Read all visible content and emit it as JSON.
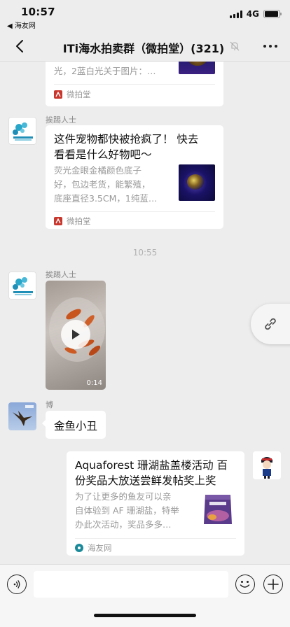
{
  "status": {
    "time": "10:57",
    "back_app": "◀ 海友网",
    "network": "4G",
    "battery_level": 0.95
  },
  "nav": {
    "title": "ITi海水拍卖群（微拍堂）(321)"
  },
  "messages": {
    "card0": {
      "desc_line1": "光，2蓝白光关于图片：…",
      "source": "微拍堂"
    },
    "card1": {
      "sender": "挨踢人士",
      "title_line1": "这件宠物都快被抢疯了！ 快去",
      "title_line2": "看看是什么好物吧～",
      "desc_line1": "荧光金眼金橘颜色底子",
      "desc_line2": "好，包边老货，能繁殖，",
      "desc_line3": "底座直径3.5CM，1纯蓝…",
      "source": "微拍堂"
    },
    "timestamp": "10:55",
    "video": {
      "sender": "挨踢人士",
      "duration": "0:14"
    },
    "text_msg": {
      "sender": "博",
      "text": "金鱼小丑"
    },
    "card2": {
      "title_line1": "Aquaforest 珊湖盐盖楼活动 百",
      "title_line2": "份奖品大放送尝鲜发帖奖上奖",
      "desc_line1": "为了让更多的鱼友可以亲",
      "desc_line2": "自体验到 AF 珊湖盐，特举",
      "desc_line3": "办此次活动，奖品多多…",
      "source": "海友网"
    }
  },
  "colors": {
    "background": "#ededed",
    "weipaitang_red": "#c8372d",
    "haiyou_teal": "#1a8a9a"
  }
}
